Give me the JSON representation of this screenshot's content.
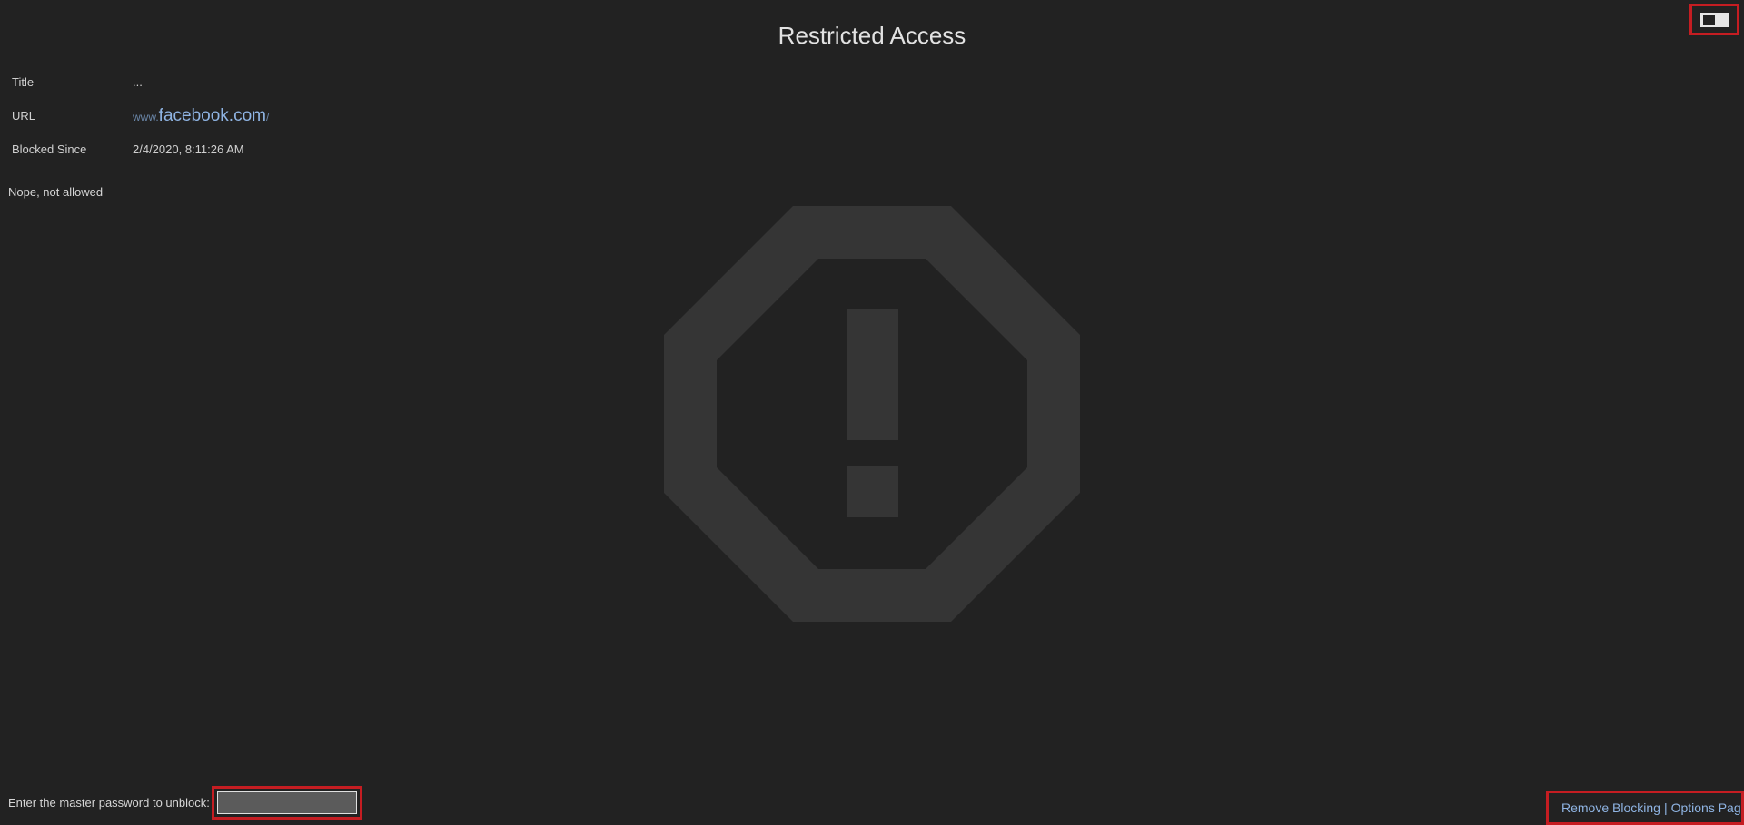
{
  "page": {
    "title": "Restricted Access",
    "message": "Nope, not allowed"
  },
  "info": {
    "title_label": "Title",
    "title_value": "...",
    "url_label": "URL",
    "url_prefix": "www.",
    "url_host": "facebook.com",
    "url_suffix": "/",
    "since_label": "Blocked Since",
    "since_value": "2/4/2020, 8:11:26 AM"
  },
  "footer": {
    "password_prompt": "Enter the master password to unblock:",
    "password_placeholder": "",
    "remove_blocking": "Remove Blocking",
    "separator": "|",
    "options_page": "Options Page"
  },
  "icons": {
    "center": "stop-warning-icon",
    "toggle": "theme-toggle-icon"
  },
  "colors": {
    "background": "#222222",
    "icon": "#353535",
    "link": "#8fb4e3",
    "highlight": "#c51d22"
  }
}
